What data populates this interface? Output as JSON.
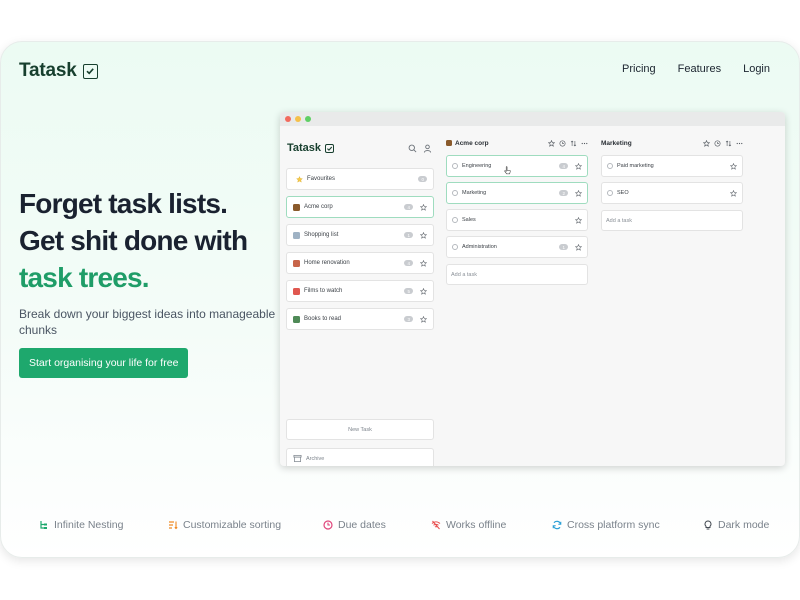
{
  "brand": {
    "name": "Tatask",
    "color": "#173f2e"
  },
  "nav": {
    "items": [
      "Pricing",
      "Features",
      "Login"
    ]
  },
  "hero": {
    "title_line1": "Forget task lists.",
    "title_line2": "Get shit done with",
    "title_line3": "task trees.",
    "subtitle": "Break down your biggest ideas into manageable chunks",
    "cta_label": "Start organising your life for free",
    "accent": "#1ea86d"
  },
  "app": {
    "brand": "Tatask",
    "sidebar_items": [
      {
        "label": "Favourites",
        "badge": "0",
        "icon": "star-icon",
        "active": false
      },
      {
        "label": "Acme corp",
        "badge": "4",
        "icon": "briefcase-icon",
        "active": true
      },
      {
        "label": "Shopping list",
        "badge": "1",
        "icon": "cart-icon",
        "active": false
      },
      {
        "label": "Home renovation",
        "badge": "4",
        "icon": "house-icon",
        "active": false
      },
      {
        "label": "Films to watch",
        "badge": "5",
        "icon": "popcorn-icon",
        "active": false
      },
      {
        "label": "Books to read",
        "badge": "3",
        "icon": "books-icon",
        "active": false
      }
    ],
    "new_task_label": "New Task",
    "archive_label": "Archive",
    "column1": {
      "title": "Acme corp",
      "tasks": [
        {
          "label": "Engineering",
          "badge": "4",
          "active": true
        },
        {
          "label": "Marketing",
          "badge": "2",
          "active": true
        },
        {
          "label": "Sales",
          "badge": "",
          "active": false
        },
        {
          "label": "Administration",
          "badge": "1",
          "active": false
        }
      ],
      "add_task": "Add a task"
    },
    "column2": {
      "title": "Marketing",
      "tasks": [
        {
          "label": "Paid marketing",
          "badge": "",
          "active": false
        },
        {
          "label": "SEO",
          "badge": "",
          "active": false
        }
      ],
      "add_task": "Add a task"
    }
  },
  "features": [
    {
      "label": "Infinite Nesting",
      "icon": "tree-icon",
      "color": "#1ea86d"
    },
    {
      "label": "Customizable sorting",
      "icon": "sort-icon",
      "color": "#f08a24"
    },
    {
      "label": "Due dates",
      "icon": "clock-icon",
      "color": "#e0457b"
    },
    {
      "label": "Works offline",
      "icon": "wifi-off-icon",
      "color": "#e84b4b"
    },
    {
      "label": "Cross platform sync",
      "icon": "sync-icon",
      "color": "#2a9fd6"
    },
    {
      "label": "Dark mode",
      "icon": "bulb-icon",
      "color": "#444a52"
    }
  ]
}
